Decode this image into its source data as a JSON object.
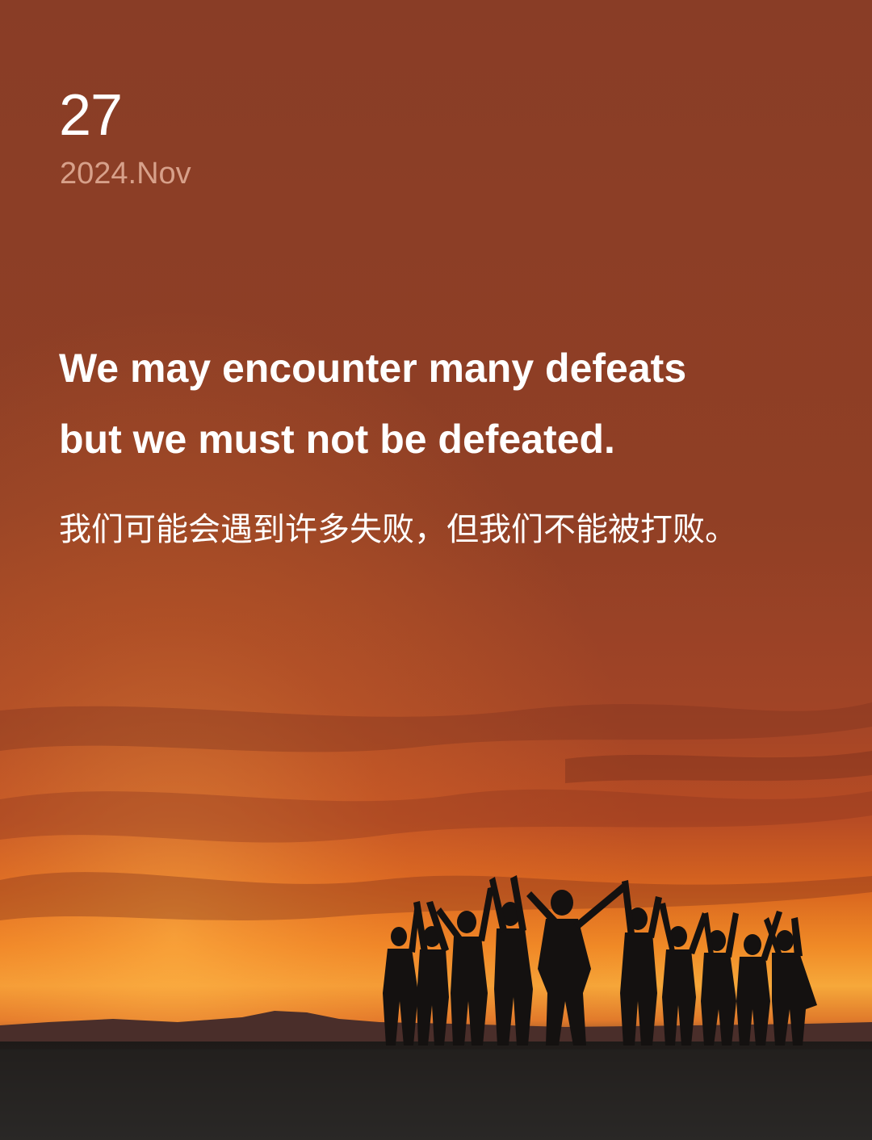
{
  "date": {
    "day": "27",
    "year_month": "2024.Nov"
  },
  "quote": {
    "english_line_1": "We may encounter many defeats",
    "english_line_2": "but we must not be defeated.",
    "chinese": "我们可能会遇到许多失败，但我们不能被打败。"
  },
  "colors": {
    "sky_top": "#8a3e26",
    "sky_mid": "#a54526",
    "horizon_glow": "#f29a2e",
    "ground": "#1c1c1c",
    "date_subtle": "#d7a08a",
    "text": "#ffffff"
  }
}
